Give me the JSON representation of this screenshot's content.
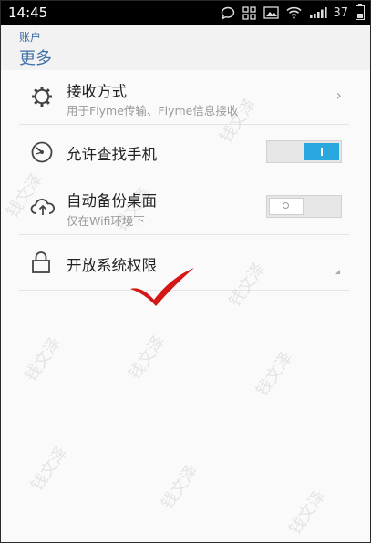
{
  "status_bar": {
    "time": "14:45",
    "battery_level": "37",
    "icons": [
      "chat-bubble-icon",
      "apps-icon",
      "image-icon",
      "wifi-icon",
      "signal-icon",
      "battery-icon"
    ]
  },
  "header": {
    "breadcrumb": "账户",
    "title": "更多"
  },
  "settings": [
    {
      "label": "接收方式",
      "description": "用于Flyme传输、Flyme信息接收",
      "icon": "gear-icon",
      "control": "chevron"
    },
    {
      "label": "允许查找手机",
      "description": "",
      "icon": "locate-icon",
      "control": "toggle",
      "checked": true
    },
    {
      "label": "自动备份桌面",
      "description": "仅在Wifi环境下",
      "icon": "cloud-upload-icon",
      "control": "toggle",
      "checked": false
    },
    {
      "label": "开放系统权限",
      "description": "",
      "icon": "lock-icon",
      "control": "expand-indicator"
    }
  ],
  "watermark": "钱文泽",
  "colors": {
    "accent": "#3f6fa8",
    "toggle_on": "#2aa7df",
    "annotation_check": "#d41717"
  }
}
